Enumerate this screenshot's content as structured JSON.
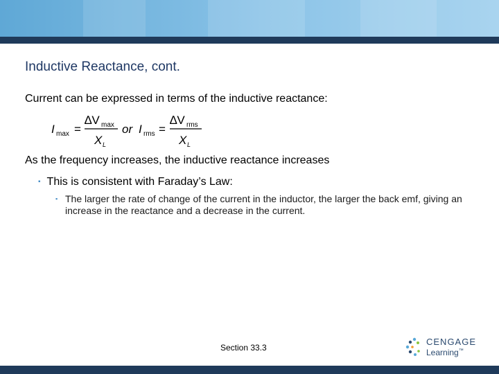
{
  "slide": {
    "title": "Inductive Reactance, cont.",
    "intro": "Current can be expressed in terms of the inductive reactance:",
    "formula": {
      "lhs1": "I",
      "lhs1_sub": "max",
      "num1": "∆V",
      "num1_sub": "max",
      "den1": "X",
      "den1_sub": "L",
      "connector": "or",
      "lhs2": "I",
      "lhs2_sub": "rms",
      "num2": "∆V",
      "num2_sub": "rms",
      "den2": "X",
      "den2_sub": "L",
      "equals": "="
    },
    "statement": "As the frequency increases, the inductive reactance increases",
    "bullet_marker": "▪",
    "bullet_1": "This is consistent with Faraday’s Law:",
    "bullet_2": "The larger the rate of change of the current in the inductor, the larger the back emf, giving an increase in the reactance and a decrease in the current.",
    "footer": "Section  33.3"
  },
  "logo": {
    "line1": "CENGAGE",
    "line2": "Learning",
    "tm": "™"
  },
  "colors": {
    "header_band": "#8cc4e8",
    "header_rule": "#1f3a5a",
    "title": "#1f3864",
    "bullet_marker": "#4a90c8"
  }
}
